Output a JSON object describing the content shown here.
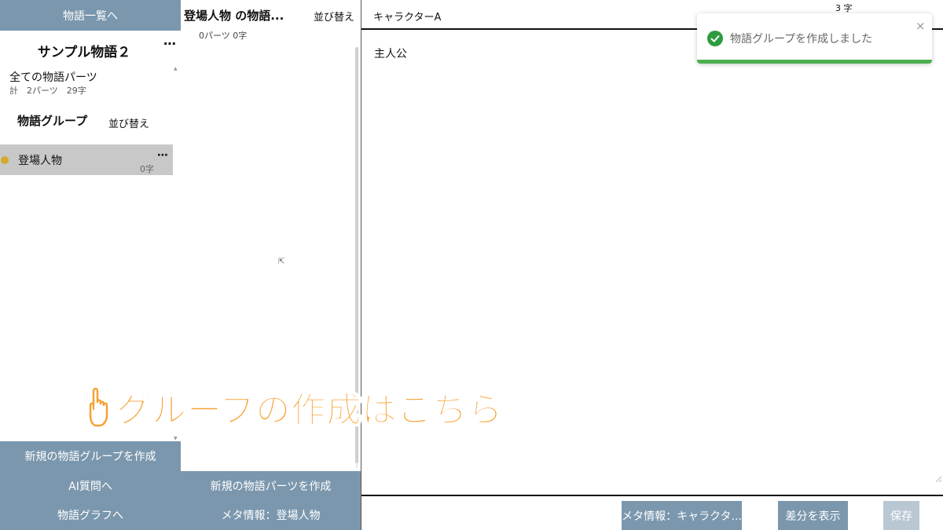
{
  "sidebar": {
    "top_button": "物語一覧へ",
    "story_title": "サンプル物語２",
    "story_menu": "⋯",
    "all_parts": {
      "label": "全ての物語パーツ",
      "summary": "計　2パーツ　29字"
    },
    "groups_heading": "物語グループ",
    "groups_sort": "並び替え",
    "groups": [
      {
        "name": "登場人物",
        "count": "0字",
        "more": "⋯",
        "color": "#d4aa2a"
      }
    ],
    "buttons": {
      "create_group": "新規の物語グループを作成",
      "ai": "AI質問へ",
      "graph": "物語グラフへ"
    }
  },
  "middle": {
    "title": "登場人物 の物語...",
    "sort": "並び替え",
    "summary": "0パーツ 0字",
    "buttons": {
      "create_part": "新規の物語パーツを作成",
      "meta": "メタ情報：登場人物"
    }
  },
  "editor": {
    "name": "キャラクターA",
    "char_count": "3 字",
    "body": "主人公",
    "buttons": {
      "meta": "メタ情報：キャラクタ...",
      "diff": "差分を表示",
      "save": "保存"
    }
  },
  "toast": {
    "message": "物語グループを作成しました",
    "close": "×",
    "accent": "#4cb050"
  },
  "overlay": {
    "caption": "グループの作成はこちら"
  },
  "colors": {
    "primary_button": "#7b97ad",
    "caption": "#f7a134",
    "selected_row": "#c8c8c8"
  }
}
